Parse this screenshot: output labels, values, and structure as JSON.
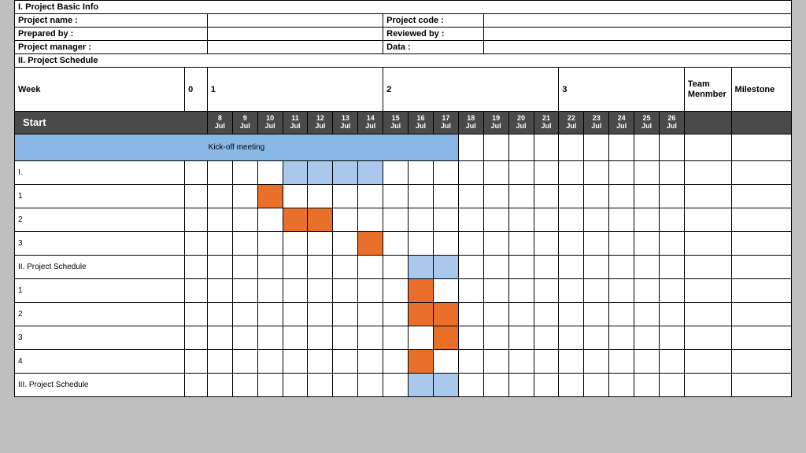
{
  "sections": {
    "basic_info_title": "I. Project Basic Info",
    "schedule_title": "II. Project Schedule"
  },
  "info_fields": {
    "project_name": "Project name :",
    "project_code": "Project code :",
    "prepared_by": "Prepared by :",
    "reviewed_by": "Reviewed by :",
    "project_manager": "Project manager :",
    "data": "Data :"
  },
  "week_header": {
    "label": "Week",
    "zero": "0",
    "w1": "1",
    "w2": "2",
    "w3": "3",
    "team": "Team Menmber",
    "milestone": "Milestone"
  },
  "start_label": "Start",
  "dates": [
    {
      "d": "8",
      "m": "Jul"
    },
    {
      "d": "9",
      "m": "Jul"
    },
    {
      "d": "10",
      "m": "Jul"
    },
    {
      "d": "11",
      "m": "Jul"
    },
    {
      "d": "12",
      "m": "Jul"
    },
    {
      "d": "13",
      "m": "Jul"
    },
    {
      "d": "14",
      "m": "Jul"
    },
    {
      "d": "15",
      "m": "Jul"
    },
    {
      "d": "16",
      "m": "Jul"
    },
    {
      "d": "17",
      "m": "Jul"
    },
    {
      "d": "18",
      "m": "Jul"
    },
    {
      "d": "19",
      "m": "Jul"
    },
    {
      "d": "20",
      "m": "Jul"
    },
    {
      "d": "21",
      "m": "Jul"
    },
    {
      "d": "22",
      "m": "Jul"
    },
    {
      "d": "23",
      "m": "Jul"
    },
    {
      "d": "24",
      "m": "Jul"
    },
    {
      "d": "25",
      "m": "Jul"
    },
    {
      "d": "26",
      "m": "Jul"
    }
  ],
  "kickoff_label": "Kick-off meeting",
  "tasks": [
    "I.",
    "1",
    "2",
    "3",
    "II. Project Schedule",
    "1",
    "2",
    "3",
    "4",
    "III. Project Schedule"
  ],
  "chart_data": {
    "type": "bar",
    "title": "Project Schedule Gantt",
    "x_dates": [
      "8 Jul",
      "9 Jul",
      "10 Jul",
      "11 Jul",
      "12 Jul",
      "13 Jul",
      "14 Jul",
      "15 Jul",
      "16 Jul",
      "17 Jul",
      "18 Jul",
      "19 Jul",
      "20 Jul",
      "21 Jul",
      "22 Jul",
      "23 Jul",
      "24 Jul",
      "25 Jul",
      "26 Jul"
    ],
    "series": [
      {
        "name": "Kick-off meeting",
        "color": "#8ab8e6",
        "cells": [
          0,
          1,
          2,
          3,
          4,
          5,
          6,
          7,
          8,
          9,
          10
        ]
      },
      {
        "name": "I.",
        "color": "#a9c8ec",
        "cells": [
          3,
          4,
          5,
          6
        ]
      },
      {
        "name": "1",
        "color": "#e8702a",
        "cells": [
          2
        ]
      },
      {
        "name": "2",
        "color": "#e8702a",
        "cells": [
          3,
          4
        ]
      },
      {
        "name": "3",
        "color": "#e8702a",
        "cells": [
          6
        ]
      },
      {
        "name": "II. Project Schedule",
        "color": "#a9c8ec",
        "cells": [
          8,
          9
        ]
      },
      {
        "name": "1 (II)",
        "color": "#e8702a",
        "cells": [
          8
        ]
      },
      {
        "name": "2 (II)",
        "color": "#e8702a",
        "cells": [
          8,
          9
        ]
      },
      {
        "name": "3 (II)",
        "color": "#e8702a",
        "cells": [
          9
        ]
      },
      {
        "name": "4 (II)",
        "color": "#e8702a",
        "cells": [
          8
        ]
      },
      {
        "name": "III. Project Schedule",
        "color": "#a9c8ec",
        "cells": [
          8,
          9
        ]
      }
    ]
  }
}
